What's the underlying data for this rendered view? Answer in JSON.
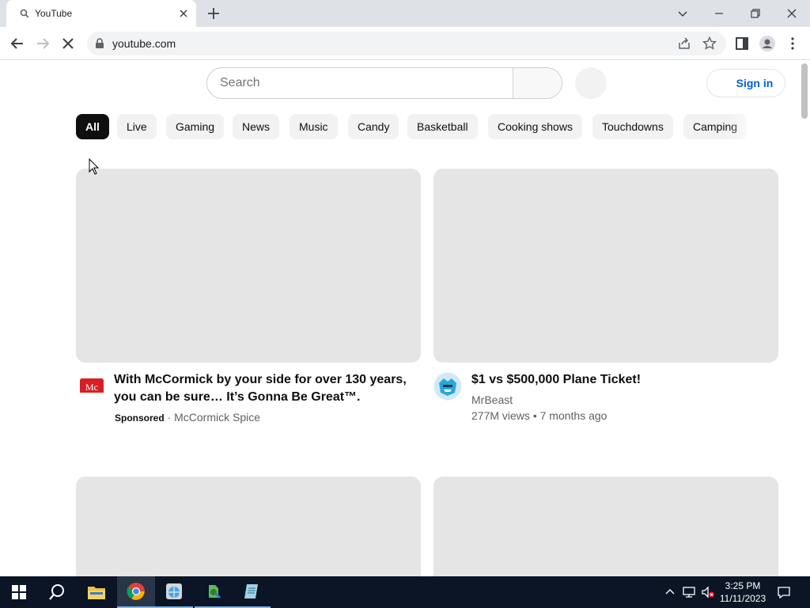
{
  "browser": {
    "tab_title": "YouTube",
    "url": "youtube.com"
  },
  "youtube": {
    "search_placeholder": "Search",
    "sign_in_label": "Sign in",
    "chips": [
      "All",
      "Live",
      "Gaming",
      "News",
      "Music",
      "Candy",
      "Basketball",
      "Cooking shows",
      "Touchdowns",
      "Camping"
    ],
    "videos": [
      {
        "title_line1": "With McCormick by your side for over 130 years,",
        "title_line2": "you can be sure… It’s Gonna Be Great™.",
        "sponsored_label": "Sponsored",
        "separator": "·",
        "channel": "McCormick Spice",
        "avatar_icon": "mccormick-logo"
      },
      {
        "title": "$1 vs $500,000 Plane Ticket!",
        "channel": "MrBeast",
        "views": "277M views",
        "separator": "•",
        "age": "7 months ago",
        "avatar_icon": "mrbeast-logo"
      }
    ]
  },
  "taskbar": {
    "time": "3:25 PM",
    "date": "11/11/2023"
  },
  "colors": {
    "accent_blue": "#065fd4",
    "chip_active": "#0f0f0f",
    "chip_bg": "#f2f2f2",
    "thumb_placeholder": "#e5e5e5",
    "taskbar_bg": "#0b1526"
  }
}
